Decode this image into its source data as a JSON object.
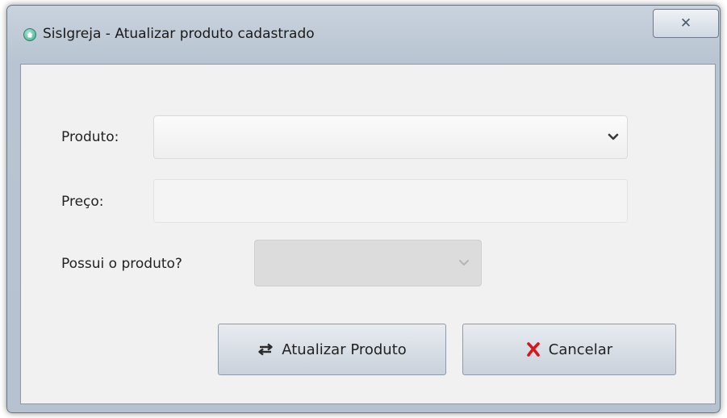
{
  "window": {
    "title": "SisIgreja - Atualizar produto cadastrado",
    "close_glyph": "✕",
    "app_icon": "church-icon"
  },
  "form": {
    "produto_label": "Produto:",
    "produto_value": "",
    "preco_label": "Preço:",
    "preco_value": "",
    "possui_label": "Possui o produto?",
    "possui_value": ""
  },
  "buttons": {
    "atualizar_label": "Atualizar Produto",
    "atualizar_icon": "swap-arrows-icon",
    "cancelar_label": "Cancelar",
    "cancelar_icon": "red-x-icon"
  },
  "colors": {
    "cancel_icon": "#d9151b",
    "titlebar": "#c3cdd8",
    "client_bg": "#f1f1f1"
  }
}
